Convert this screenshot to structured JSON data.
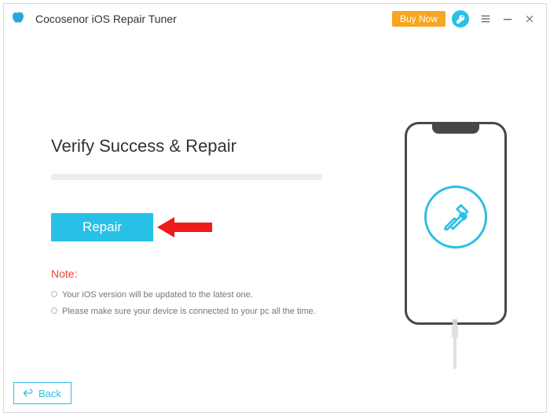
{
  "titlebar": {
    "app_title": "Cocosenor iOS Repair Tuner",
    "buy_now": "Buy Now"
  },
  "main": {
    "heading": "Verify Success & Repair",
    "repair_button": "Repair",
    "note_label": "Note:",
    "notes": {
      "n1": "Your iOS version will be updated to the latest one.",
      "n2": "Please make sure your device is connected to your pc all the time."
    }
  },
  "footer": {
    "back": "Back"
  },
  "colors": {
    "accent": "#29c0e7",
    "buy_now_bg": "#f5a623",
    "note_red": "#ee4433"
  }
}
